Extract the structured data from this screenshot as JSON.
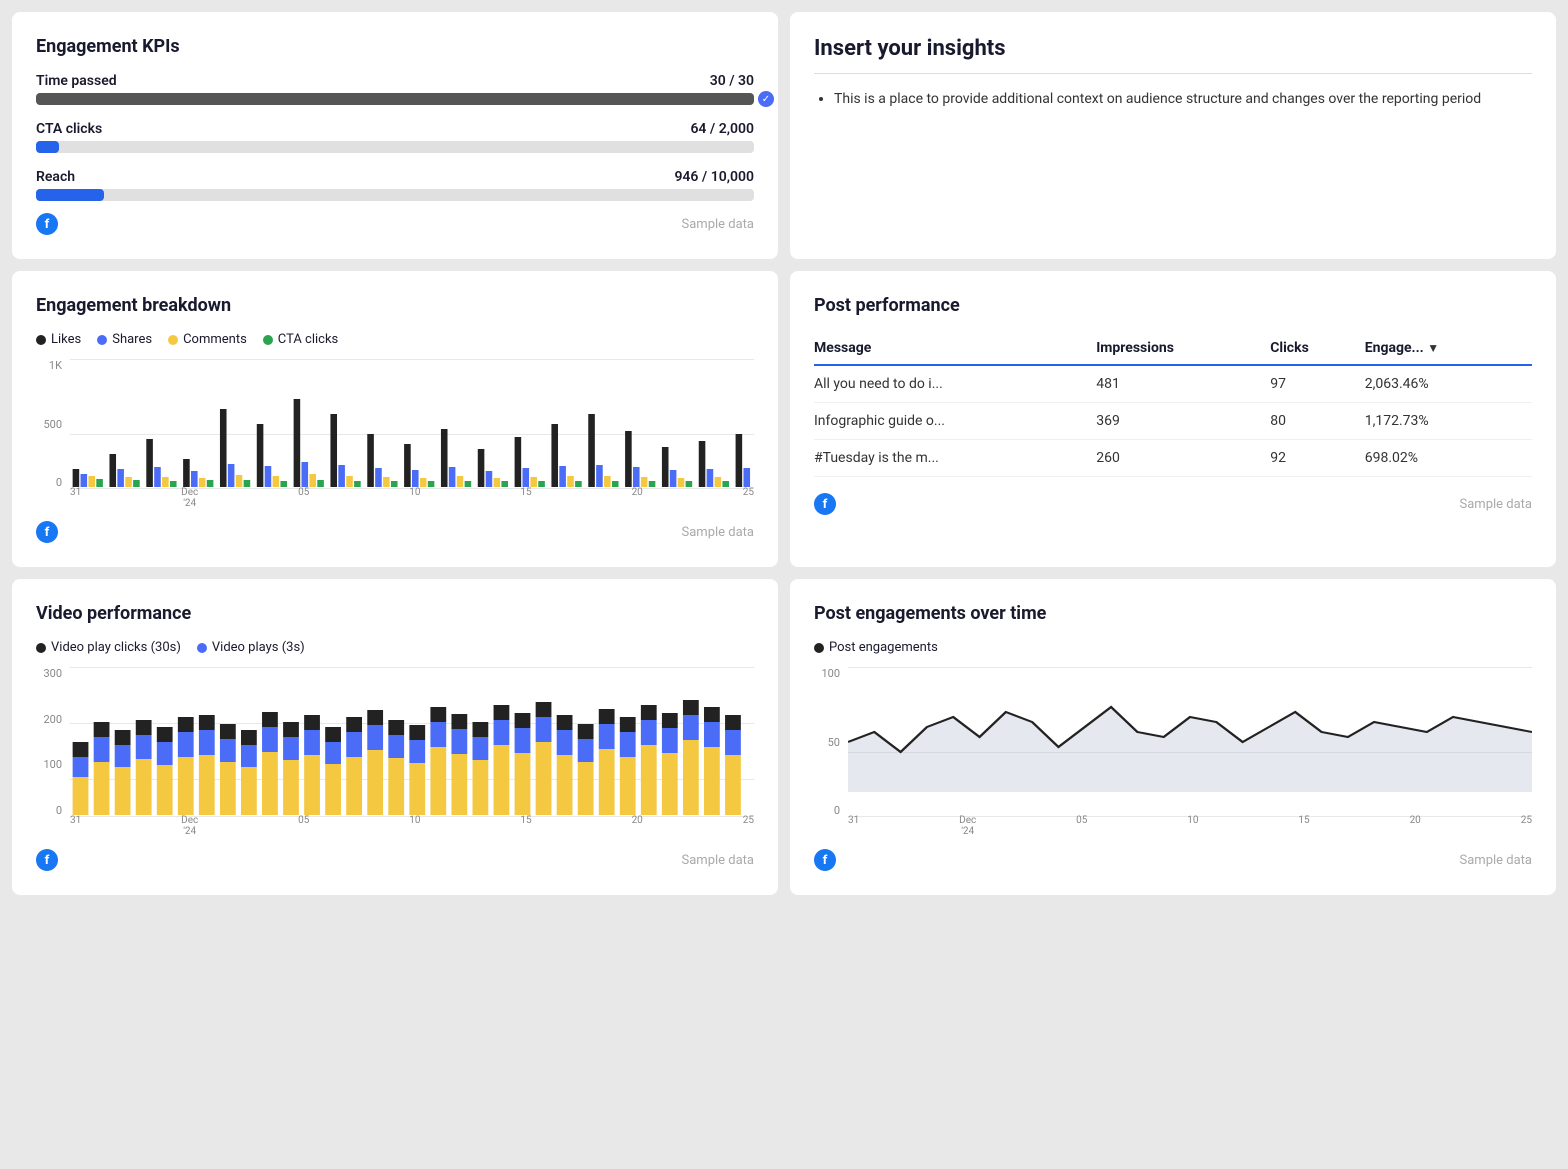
{
  "kpi": {
    "title": "Engagement KPIs",
    "metrics": [
      {
        "label": "Time passed",
        "value": "30 / 30",
        "percent": 100,
        "color": "#555",
        "showCheck": true
      },
      {
        "label": "CTA clicks",
        "value": "64 / 2,000",
        "percent": 3.2,
        "color": "#2563eb",
        "showCheck": false
      },
      {
        "label": "Reach",
        "value": "946 / 10,000",
        "percent": 9.46,
        "color": "#2563eb",
        "showCheck": false
      }
    ],
    "sample_data": "Sample data"
  },
  "insights": {
    "title": "Insert your insights",
    "items": [
      "This is a place to provide additional context on audience structure and changes over the reporting period"
    ]
  },
  "engagement_breakdown": {
    "title": "Engagement breakdown",
    "legend": [
      {
        "label": "Likes",
        "color": "#222"
      },
      {
        "label": "Shares",
        "color": "#4a6cf7"
      },
      {
        "label": "Comments",
        "color": "#f5c842"
      },
      {
        "label": "CTA clicks",
        "color": "#2aa44f"
      }
    ],
    "y_labels": [
      "1K",
      "500",
      "0"
    ],
    "x_labels": [
      "31",
      "Dec\n'24",
      "05",
      "10",
      "15",
      "20",
      "25"
    ],
    "sample_data": "Sample data"
  },
  "post_performance": {
    "title": "Post performance",
    "columns": [
      "Message",
      "Impressions",
      "Clicks",
      "Engage..."
    ],
    "rows": [
      {
        "message": "All you need to do i...",
        "impressions": "481",
        "clicks": "97",
        "engagement": "2,063.46%"
      },
      {
        "message": "Infographic guide o...",
        "impressions": "369",
        "clicks": "80",
        "engagement": "1,172.73%"
      },
      {
        "message": "#Tuesday is the m...",
        "impressions": "260",
        "clicks": "92",
        "engagement": "698.02%"
      }
    ],
    "sample_data": "Sample data"
  },
  "video_performance": {
    "title": "Video performance",
    "legend": [
      {
        "label": "Video play clicks (30s)",
        "color": "#222"
      },
      {
        "label": "Video plays (3s)",
        "color": "#4a6cf7"
      }
    ],
    "y_labels": [
      "300",
      "200",
      "100",
      "0"
    ],
    "x_labels": [
      "31",
      "Dec\n'24",
      "05",
      "10",
      "15",
      "20",
      "25"
    ],
    "sample_data": "Sample data"
  },
  "post_engagements": {
    "title": "Post engagements over time",
    "legend": [
      {
        "label": "Post engagements",
        "color": "#222"
      }
    ],
    "y_labels": [
      "100",
      "50",
      "0"
    ],
    "x_labels": [
      "31",
      "Dec\n'24",
      "05",
      "10",
      "15",
      "20",
      "25"
    ],
    "sample_data": "Sample data"
  }
}
